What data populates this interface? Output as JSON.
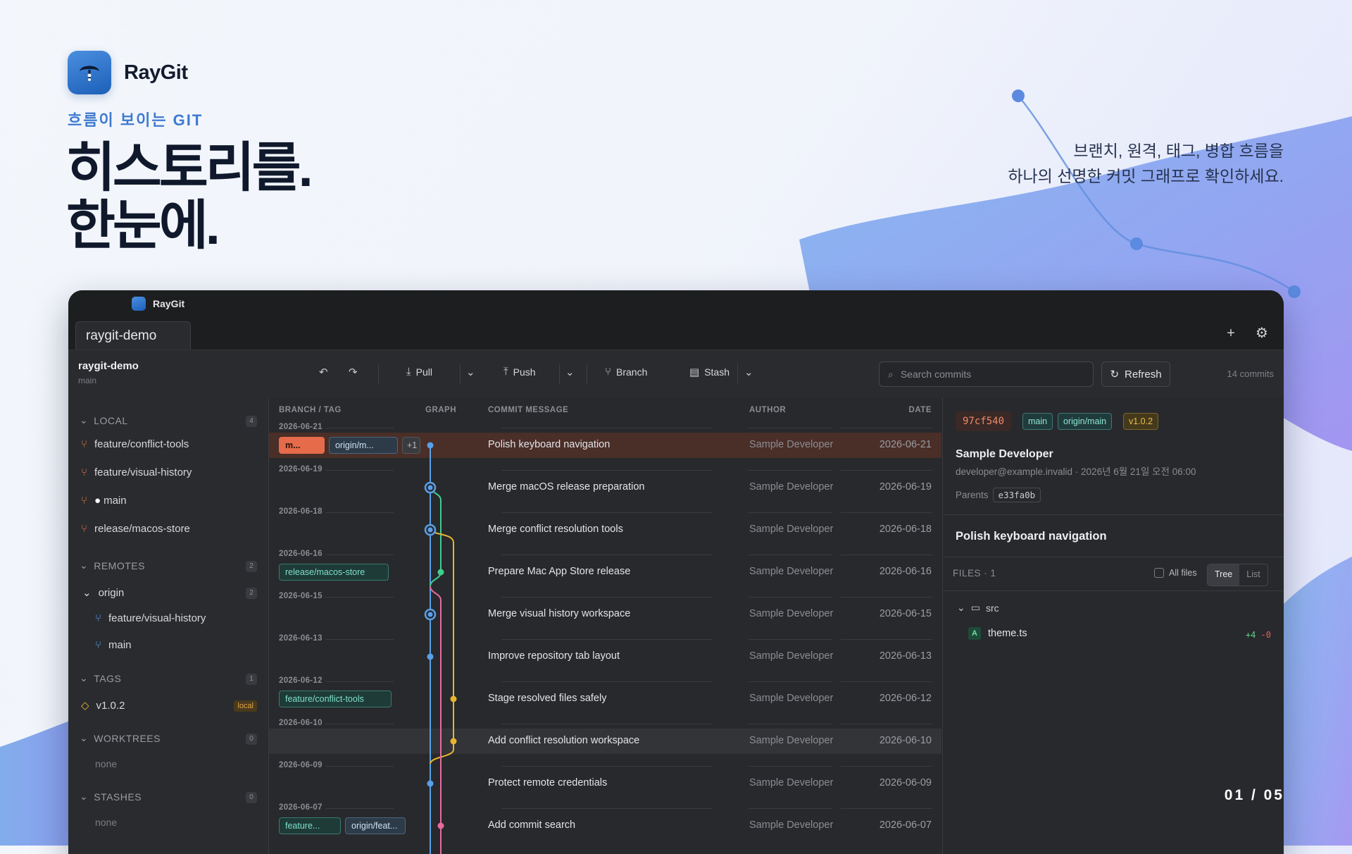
{
  "hero": {
    "brand": "RayGit",
    "eyebrow": "흐름이 보이는 GIT",
    "headline_1": "히스토리를.",
    "headline_2": "한눈에.",
    "subcopy_1": "브랜치, 원격, 태그, 병합 흐름을",
    "subcopy_2": "하나의 선명한 커밋 그래프로 확인하세요.",
    "pager": "01 / 05"
  },
  "window": {
    "title": "RayGit",
    "tab": "raygit-demo"
  },
  "toolbar": {
    "repo_name": "raygit-demo",
    "repo_branch": "main",
    "pull": "Pull",
    "push": "Push",
    "branch": "Branch",
    "stash": "Stash",
    "search_placeholder": "Search commits",
    "refresh": "Refresh",
    "commit_count": "14 commits"
  },
  "sidebar": {
    "local": {
      "label": "LOCAL",
      "count": "4",
      "items": [
        "feature/conflict-tools",
        "feature/visual-history",
        "main",
        "release/macos-store"
      ]
    },
    "remotes": {
      "label": "REMOTES",
      "count": "2",
      "origin": "origin",
      "origin_count": "2",
      "items": [
        "feature/visual-history",
        "main"
      ]
    },
    "tags": {
      "label": "TAGS",
      "count": "1",
      "items": [
        "v1.0.2"
      ],
      "tag_badge": "local"
    },
    "worktrees": {
      "label": "WORKTREES",
      "count": "0",
      "empty": "none"
    },
    "stashes": {
      "label": "STASHES",
      "count": "0",
      "empty": "none"
    }
  },
  "columns": {
    "branch_tag": "BRANCH / TAG",
    "graph": "GRAPH",
    "message": "COMMIT MESSAGE",
    "author": "AUTHOR",
    "date": "DATE"
  },
  "commits": [
    {
      "group": "2026-06-21",
      "message": "Polish keyboard navigation",
      "author": "Sample Developer",
      "date": "2026-06-21",
      "refs": [
        "m...",
        "origin/m...",
        "+1"
      ]
    },
    {
      "group": "2026-06-19",
      "message": "Merge macOS release preparation",
      "author": "Sample Developer",
      "date": "2026-06-19"
    },
    {
      "group": "2026-06-18",
      "message": "Merge conflict resolution tools",
      "author": "Sample Developer",
      "date": "2026-06-18"
    },
    {
      "group": "2026-06-16",
      "message": "Prepare Mac App Store release",
      "author": "Sample Developer",
      "date": "2026-06-16",
      "refs": [
        "release/macos-store"
      ]
    },
    {
      "group": "2026-06-15",
      "message": "Merge visual history workspace",
      "author": "Sample Developer",
      "date": "2026-06-15"
    },
    {
      "group": "2026-06-13",
      "message": "Improve repository tab layout",
      "author": "Sample Developer",
      "date": "2026-06-13"
    },
    {
      "group": "2026-06-12",
      "message": "Stage resolved files safely",
      "author": "Sample Developer",
      "date": "2026-06-12",
      "refs": [
        "feature/conflict-tools"
      ]
    },
    {
      "group": "2026-06-10",
      "message": "Add conflict resolution workspace",
      "author": "Sample Developer",
      "date": "2026-06-10"
    },
    {
      "group": "2026-06-09",
      "message": "Protect remote credentials",
      "author": "Sample Developer",
      "date": "2026-06-09"
    },
    {
      "group": "2026-06-07",
      "message": "Add commit search",
      "author": "Sample Developer",
      "date": "2026-06-07",
      "refs": [
        "feature...",
        "origin/feat..."
      ]
    }
  ],
  "detail": {
    "hash": "97cf540",
    "refs": [
      "main",
      "origin/main",
      "v1.0.2"
    ],
    "author": "Sample Developer",
    "meta": "developer@example.invalid · 2026년 6월 21일 오전 06:00",
    "parents_label": "Parents",
    "parent_hash": "e33fa0b",
    "subject": "Polish keyboard navigation",
    "files_label": "FILES · 1",
    "all_files": "All files",
    "view_tree": "Tree",
    "view_list": "List",
    "folder": "src",
    "file": "theme.ts",
    "file_status": "A",
    "additions": "+4",
    "deletions": "-0"
  },
  "colors": {
    "accent": "#3e7ad0",
    "head": "#e66b4a",
    "lane_blue": "#5aa0e8",
    "lane_green": "#3ecf8e",
    "lane_yellow": "#e8b530",
    "lane_pink": "#e86aa0"
  }
}
